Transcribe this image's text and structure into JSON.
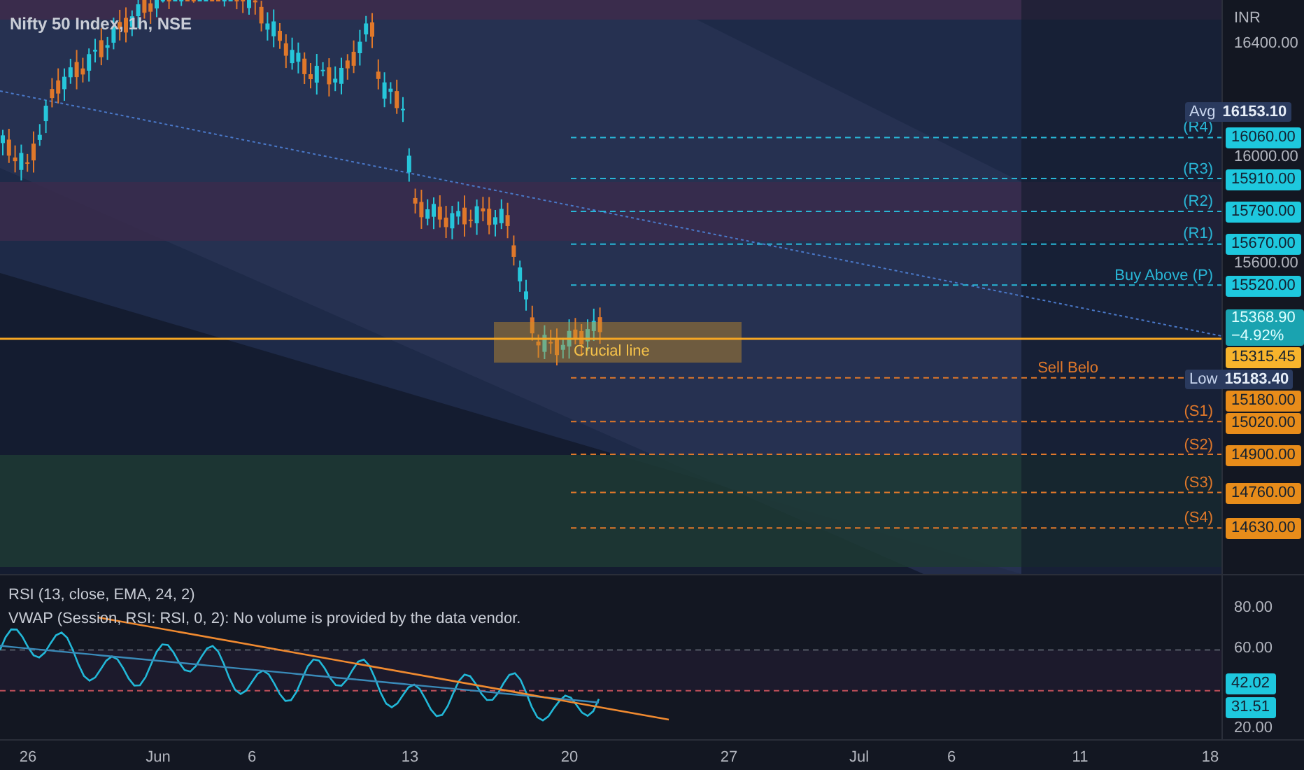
{
  "title": "Nifty 50 Index, 1h, NSE",
  "currency": "INR",
  "price_ticks": [
    "16400.00",
    "16000.00",
    "15600.00"
  ],
  "levels": [
    {
      "label": "(R4)",
      "price": "16060.00",
      "kind": "resistance"
    },
    {
      "label": "(R3)",
      "price": "15910.00",
      "kind": "resistance"
    },
    {
      "label": "(R2)",
      "price": "15790.00",
      "kind": "resistance"
    },
    {
      "label": "(R1)",
      "price": "15670.00",
      "kind": "resistance"
    },
    {
      "label": "Buy Above (P)",
      "price": "15520.00",
      "kind": "resistance"
    },
    {
      "label": "Sell Belo",
      "price": "15180.00",
      "kind": "support"
    },
    {
      "label": "(S1)",
      "price": "15020.00",
      "kind": "support"
    },
    {
      "label": "(S2)",
      "price": "14900.00",
      "kind": "support"
    },
    {
      "label": "(S3)",
      "price": "14760.00",
      "kind": "support"
    },
    {
      "label": "(S4)",
      "price": "14630.00",
      "kind": "support"
    }
  ],
  "markers": [
    {
      "kind": "stat",
      "label": "Avg",
      "price": "16153.10"
    },
    {
      "kind": "last",
      "price": "15368.90",
      "change": "−4.92%"
    },
    {
      "kind": "line",
      "price": "15315.45"
    },
    {
      "kind": "stat",
      "label": "Low",
      "price": "15183.40"
    }
  ],
  "crucial_line": {
    "label": "Crucial line"
  },
  "rsi": {
    "title": "RSI (13, close, EMA, 24, 2)",
    "note": "VWAP (Session, RSI: RSI, 0, 2): No volume is provided by the data vendor.",
    "ticks": [
      "80.00",
      "60.00",
      "20.00"
    ],
    "values": [
      "42.02",
      "31.51"
    ]
  },
  "time_axis": [
    "26",
    "Jun",
    "6",
    "13",
    "20",
    "27",
    "Jul",
    "6",
    "11",
    "18"
  ]
}
